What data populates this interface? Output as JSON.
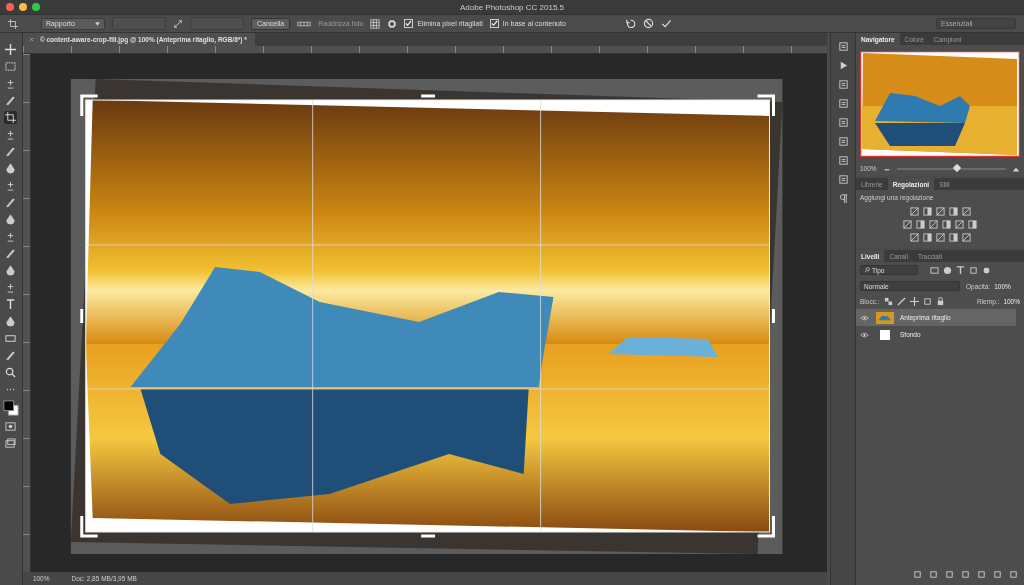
{
  "window": {
    "title": "Adobe Photoshop CC 2015.5"
  },
  "options_bar": {
    "ratio": "Rapporto",
    "cancel_button": "Cancella",
    "straighten_button": "Raddrizza foto",
    "options": [
      {
        "label": "Elimina pixel ritagliati",
        "checked": true
      },
      {
        "label": "In base al contenuto",
        "checked": true
      }
    ],
    "workspace": "Essenziali"
  },
  "document_tab": {
    "title": "© content-aware-crop-fill.jpg @ 100% (Anteprima ritaglio, RGB/8*) *"
  },
  "tools": [
    {
      "selected": false
    },
    {
      "selected": false
    },
    {
      "selected": false
    },
    {
      "selected": false
    },
    {
      "selected": true
    },
    {
      "selected": false
    },
    {
      "selected": false
    },
    {
      "selected": false
    },
    {
      "selected": false
    },
    {
      "selected": false
    },
    {
      "selected": false
    },
    {
      "selected": false
    },
    {
      "selected": false
    },
    {
      "selected": false
    },
    {
      "selected": false
    },
    {
      "selected": false
    },
    {
      "selected": false
    },
    {
      "selected": false
    },
    {
      "selected": false
    },
    {
      "selected": false
    },
    {
      "selected": false
    }
  ],
  "navigator": {
    "tabs": [
      {
        "label": "Navigatore",
        "selected": true
      },
      {
        "label": "Colore",
        "selected": false
      },
      {
        "label": "Campioni",
        "selected": false
      }
    ],
    "zoom": "100%",
    "level": 0.55
  },
  "adjustments": {
    "tabs": [
      {
        "label": "Librerie",
        "selected": false
      },
      {
        "label": "Regolazioni",
        "selected": true
      },
      {
        "label": "Stili",
        "selected": false
      }
    ],
    "hint": "Aggiungi una regolazione"
  },
  "layers_panel": {
    "tabs": [
      {
        "label": "Livelli",
        "selected": true
      },
      {
        "label": "Canali",
        "selected": false
      },
      {
        "label": "Tracciati",
        "selected": false
      }
    ],
    "filter": "Tipo",
    "blend_mode": "Normale",
    "opacity_label": "Opacità:",
    "opacity": "100%",
    "lock_label": "Blocc.:",
    "fill_label": "Riemp.:",
    "fill": "100%",
    "layers": [
      {
        "name": "Anteprima ritaglio",
        "selected": true,
        "visible": true,
        "kind": "image"
      },
      {
        "name": "Sfondo",
        "selected": false,
        "visible": true,
        "kind": "white"
      }
    ]
  },
  "status_bar": {
    "zoom": "100%",
    "doc_info": "Doc: 2,85 MB/3,95 MB"
  }
}
